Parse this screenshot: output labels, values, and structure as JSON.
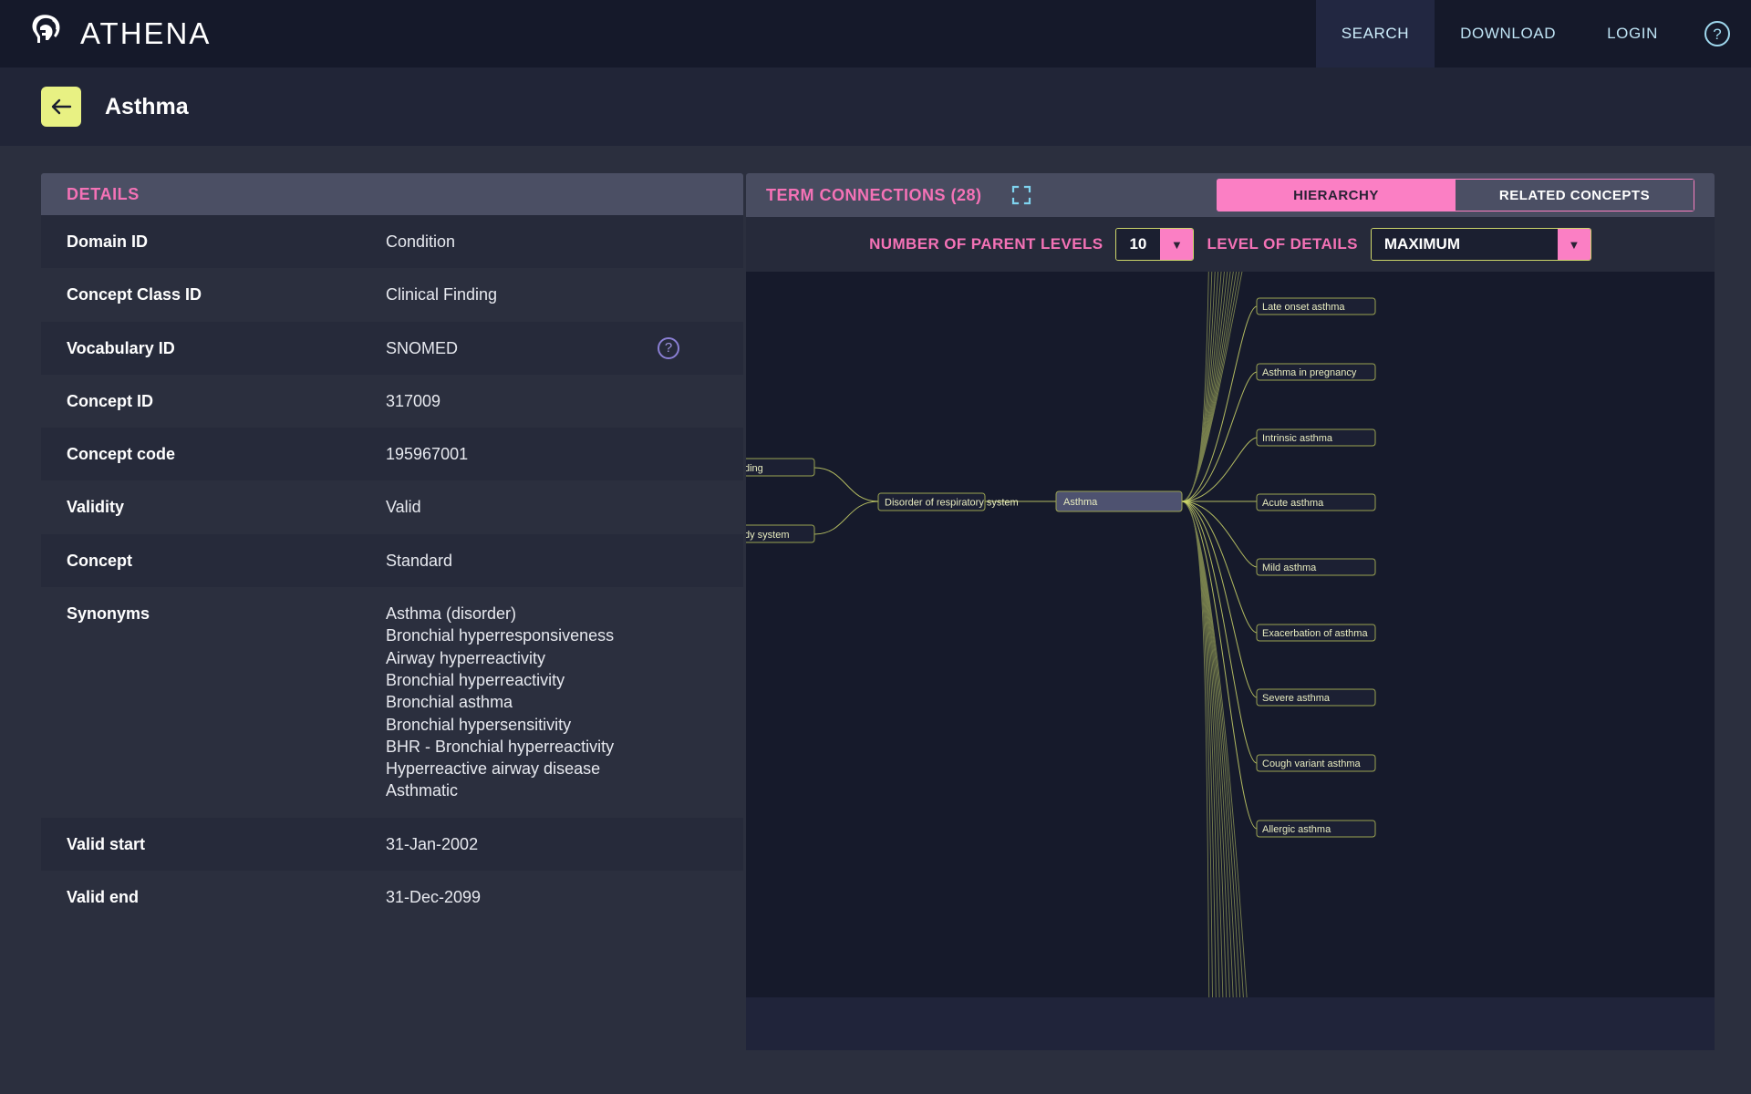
{
  "brand": {
    "name": "ATHENA",
    "logo_icon": "spartan-helmet-icon"
  },
  "nav": {
    "items": [
      {
        "label": "SEARCH",
        "active": true
      },
      {
        "label": "DOWNLOAD",
        "active": false
      },
      {
        "label": "LOGIN",
        "active": false
      }
    ],
    "help_icon": "question-mark-circle-icon",
    "help_label": "?"
  },
  "subheader": {
    "back_icon": "back-arrow-icon",
    "title": "Asthma"
  },
  "details": {
    "header": "DETAILS",
    "help_icon": "question-mark-circle-icon",
    "help_label": "?",
    "rows": [
      {
        "key": "Domain ID",
        "value": "Condition"
      },
      {
        "key": "Concept Class ID",
        "value": "Clinical Finding"
      },
      {
        "key": "Vocabulary ID",
        "value": "SNOMED",
        "has_help": true
      },
      {
        "key": "Concept ID",
        "value": "317009"
      },
      {
        "key": "Concept code",
        "value": "195967001"
      },
      {
        "key": "Validity",
        "value": "Valid"
      },
      {
        "key": "Concept",
        "value": "Standard"
      },
      {
        "key": "Synonyms",
        "value": "",
        "lines": [
          "Asthma (disorder)",
          "Bronchial hyperresponsiveness",
          "Airway hyperreactivity",
          "Bronchial hyperreactivity",
          "Bronchial asthma",
          "Bronchial hypersensitivity",
          "BHR - Bronchial hyperreactivity",
          "Hyperreactive airway disease",
          "Asthmatic"
        ]
      },
      {
        "key": "Valid start",
        "value": "31-Jan-2002"
      },
      {
        "key": "Valid end",
        "value": "31-Dec-2099"
      }
    ]
  },
  "graph": {
    "title": "TERM CONNECTIONS (28)",
    "connection_count": 28,
    "fullscreen_icon": "fullscreen-expand-icon",
    "tabs": [
      {
        "label": "HIERARCHY",
        "active": true
      },
      {
        "label": "RELATED CONCEPTS",
        "active": false
      }
    ],
    "controls": [
      {
        "label": "NUMBER OF PARENT LEVELS",
        "value": "10",
        "icon": "chevron-down-icon"
      },
      {
        "label": "LEVEL OF DETAILS",
        "value": "MAXIMUM",
        "icon": "chevron-down-icon"
      }
    ],
    "nodes": {
      "focus": "Asthma",
      "parents": [
        {
          "label": "Disorder of respiratory system"
        },
        {
          "label": "ding",
          "truncated": true
        },
        {
          "label": "dy system",
          "truncated": true
        }
      ],
      "children": [
        "Late onset asthma",
        "Asthma in pregnancy",
        "Intrinsic asthma",
        "Acute asthma",
        "Mild asthma",
        "Exacerbation of asthma",
        "Severe asthma",
        "Cough variant asthma",
        "Allergic asthma"
      ]
    }
  },
  "colors": {
    "accent_pink": "#f472b6",
    "tab_active": "#fb7fc4",
    "edge_yellow": "#cdd66a",
    "back_button": "#e8f183",
    "nav_text": "#bfe4f5",
    "canvas_bg": "#161a2b"
  }
}
